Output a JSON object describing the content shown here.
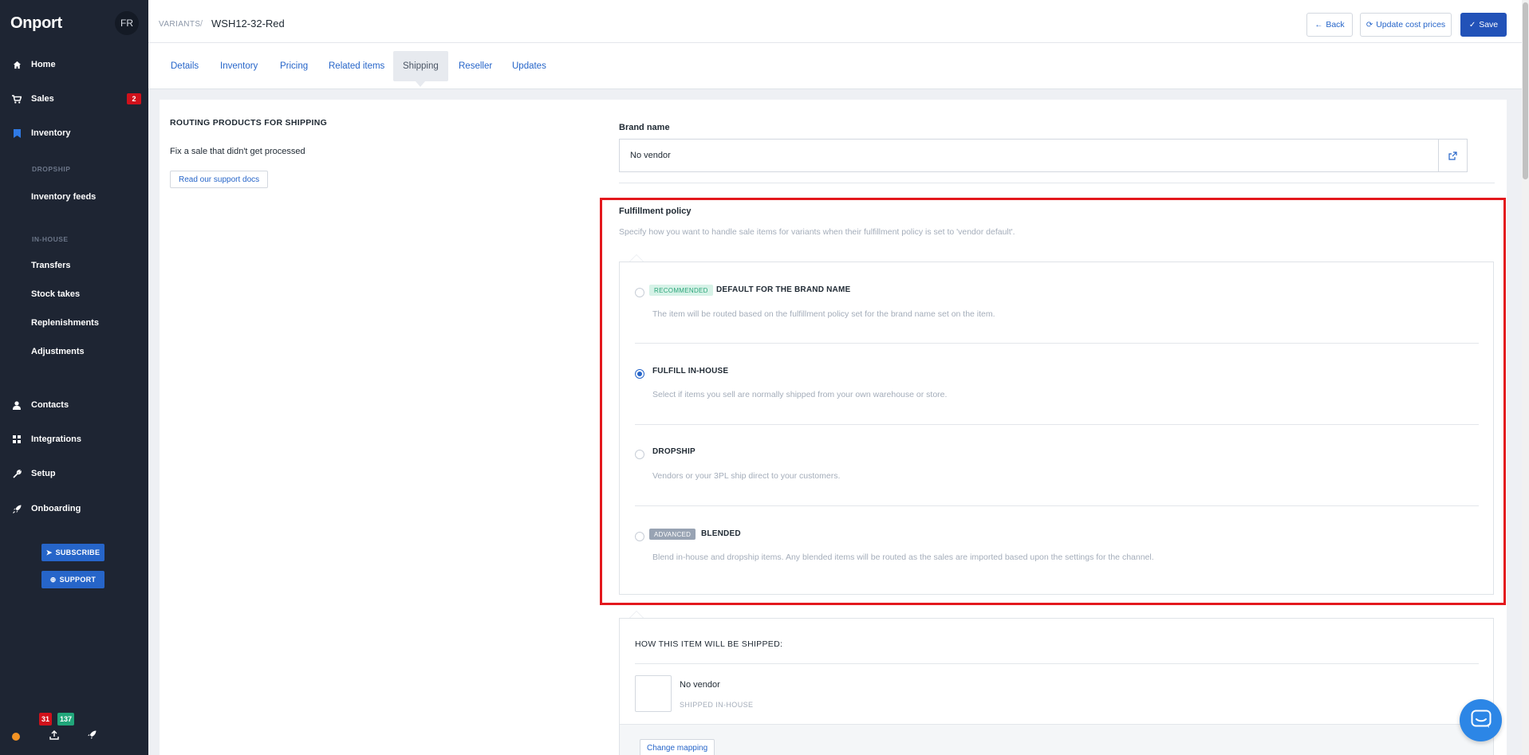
{
  "sidebar": {
    "logo": "Onport",
    "avatar": "FR",
    "items": [
      {
        "label": "Home",
        "icon": "home-icon"
      },
      {
        "label": "Sales",
        "icon": "cart-icon",
        "badge": "2"
      },
      {
        "label": "Inventory",
        "icon": "bookmark-icon"
      },
      {
        "label": "Contacts",
        "icon": "user-icon"
      },
      {
        "label": "Integrations",
        "icon": "grid-icon"
      },
      {
        "label": "Setup",
        "icon": "wrench-icon"
      },
      {
        "label": "Onboarding",
        "icon": "rocket-icon"
      }
    ],
    "sections": {
      "dropship": "DROPSHIP",
      "inhouse": "IN-HOUSE"
    },
    "sub_items": {
      "inventory_feeds": "Inventory feeds",
      "transfers": "Transfers",
      "stock_takes": "Stock takes",
      "replenishments": "Replenishments",
      "adjustments": "Adjustments"
    },
    "subscribe": "SUBSCRIBE",
    "support": "SUPPORT",
    "footer_badges": {
      "red": "31",
      "green": "137"
    }
  },
  "header": {
    "breadcrumb": "VARIANTS",
    "separator": "/",
    "title": "WSH12-32-Red",
    "back_label": "Back",
    "update_cost_label": "Update cost prices",
    "save_label": "Save"
  },
  "tabs": [
    "Details",
    "Inventory",
    "Pricing",
    "Related items",
    "Shipping",
    "Reseller",
    "Updates"
  ],
  "active_tab": "Shipping",
  "routing": {
    "title": "ROUTING PRODUCTS FOR SHIPPING",
    "text": "Fix a sale that didn't get processed",
    "docs_button": "Read our support docs"
  },
  "brand": {
    "label": "Brand name",
    "value": "No vendor"
  },
  "fulfillment": {
    "title": "Fulfillment policy",
    "description": "Specify how you want to handle sale items for variants when their fulfillment policy is set to 'vendor default'.",
    "options": [
      {
        "tag": "RECOMMENDED",
        "label": "DEFAULT FOR THE BRAND NAME",
        "description": "The item will be routed based on the fulfillment policy set for the brand name set on the item.",
        "selected": false
      },
      {
        "tag": "",
        "label": "FULFILL IN-HOUSE",
        "description": "Select if items you sell are normally shipped from your own warehouse or store.",
        "selected": true
      },
      {
        "tag": "",
        "label": "DROPSHIP",
        "description": "Vendors or your 3PL ship direct to your customers.",
        "selected": false
      },
      {
        "tag": "ADVANCED",
        "label": "BLENDED",
        "description": "Blend in-house and dropship items. Any blended items will be routed as the sales are imported based upon the settings for the channel.",
        "selected": false
      }
    ]
  },
  "shipping": {
    "title": "HOW THIS ITEM WILL BE SHIPPED:",
    "vendor": "No vendor",
    "method": "SHIPPED IN-HOUSE",
    "change_button": "Change mapping"
  },
  "colors": {
    "sidebar": "#1e2533",
    "accent": "#2665c9",
    "primary_button": "#2252b8",
    "badge_red": "#d0111b",
    "badge_green": "#21a67a",
    "highlight": "#e3181d"
  }
}
